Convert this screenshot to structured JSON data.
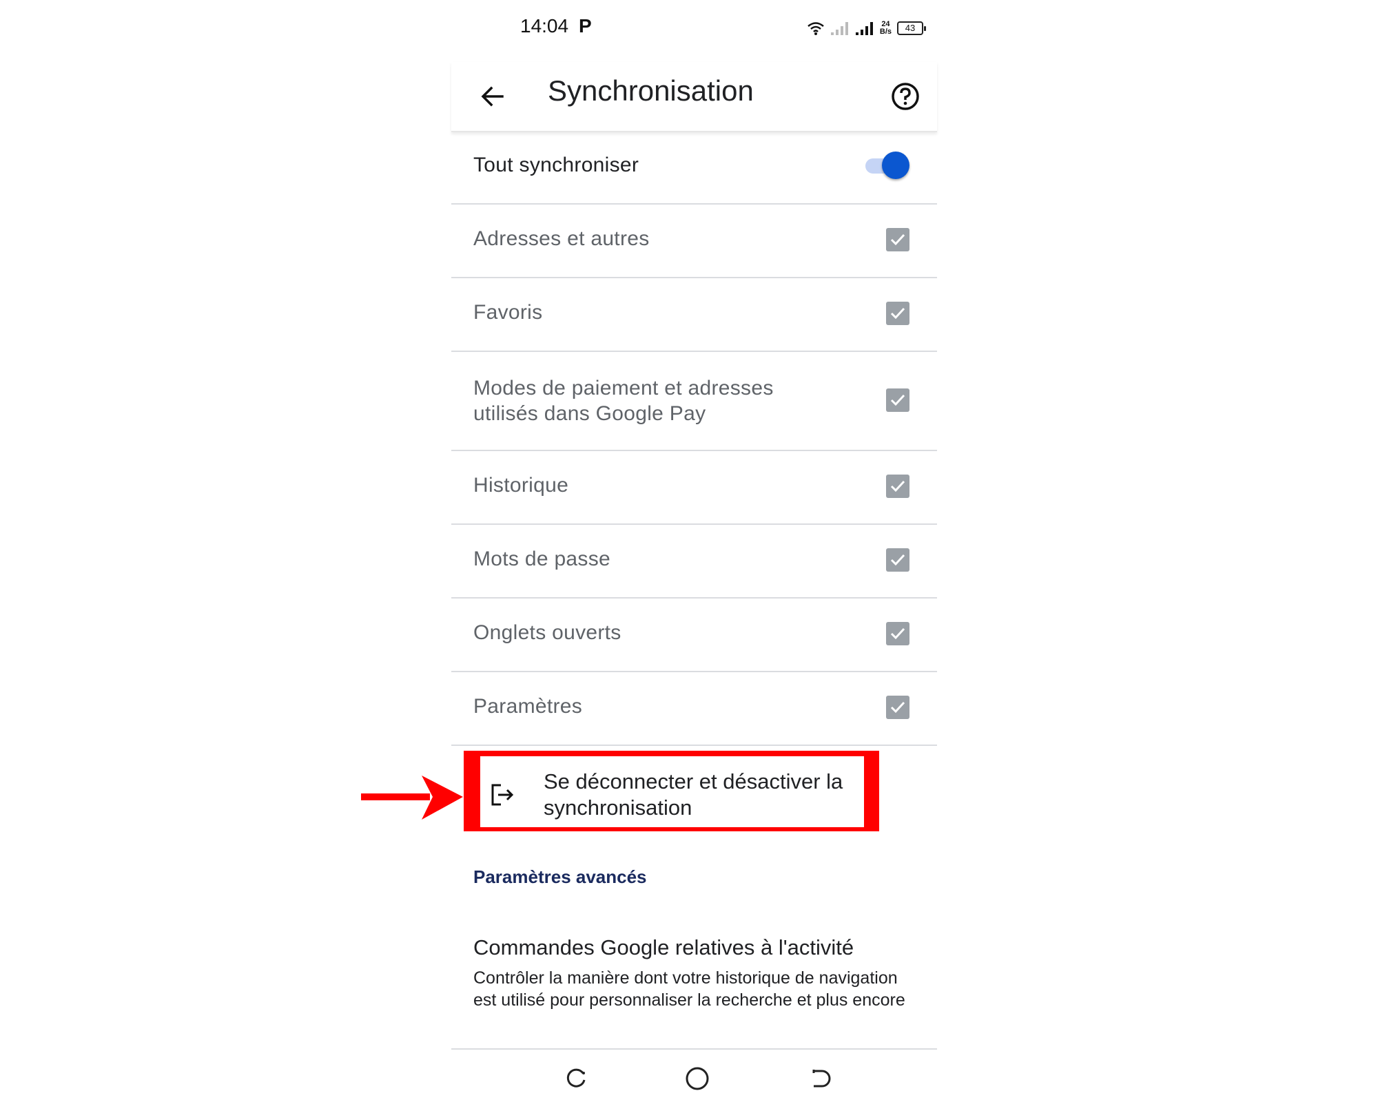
{
  "status_bar": {
    "time": "14:04",
    "notification": "P",
    "speed_value": "24",
    "speed_unit": "B/s",
    "battery": "43"
  },
  "app_bar": {
    "title": "Synchronisation",
    "back_icon": "arrow-left-icon",
    "help_icon": "help-circle-icon"
  },
  "sync_all": {
    "label": "Tout synchroniser",
    "enabled": true
  },
  "items": [
    {
      "label": "Adresses et autres",
      "checked": true
    },
    {
      "label": "Favoris",
      "checked": true
    },
    {
      "label": "Modes de paiement et adresses utilisés dans Google Pay",
      "checked": true
    },
    {
      "label": "Historique",
      "checked": true
    },
    {
      "label": "Mots de passe",
      "checked": true
    },
    {
      "label": "Onglets ouverts",
      "checked": true
    },
    {
      "label": "Paramètres",
      "checked": true
    }
  ],
  "sign_out": {
    "label": "Se déconnecter et désactiver la synchronisation",
    "icon": "logout-icon"
  },
  "advanced": {
    "heading": "Paramètres avancés"
  },
  "activity": {
    "title": "Commandes Google relatives à l'activité",
    "description": "Contrôler la manière dont votre historique de navigation est utilisé pour personnaliser la recherche et plus encore"
  },
  "nav": [
    "recents-icon",
    "home-icon",
    "back-icon"
  ],
  "colors": {
    "accent": "#0b57d0",
    "highlight": "#ff0000",
    "checkbox": "#9aa0a6",
    "section_heading": "#1a2a5e"
  }
}
